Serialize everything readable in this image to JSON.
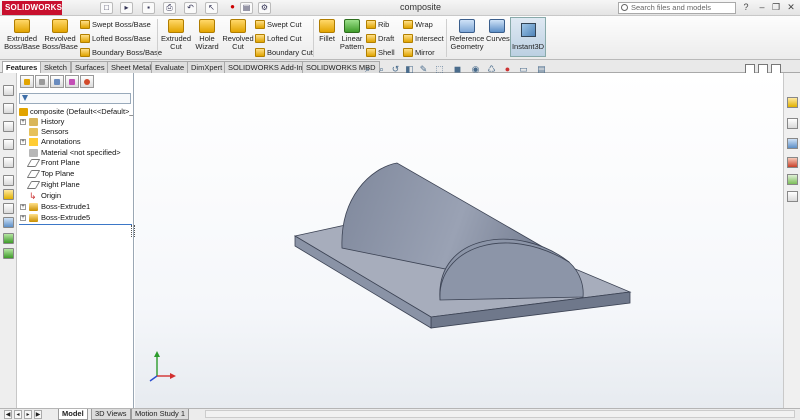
{
  "app": {
    "logo_text": "SOLIDWORKS",
    "doc_title": "composite"
  },
  "search": {
    "placeholder": "Search files and models"
  },
  "toolbar": {
    "extruded_boss": "Extruded\nBoss/Base",
    "revolved_boss": "Revolved\nBoss/Base",
    "swept_boss": "Swept Boss/Base",
    "lofted_boss": "Lofted Boss/Base",
    "boundary_boss": "Boundary Boss/Base",
    "extruded_cut": "Extruded\nCut",
    "hole_wizard": "Hole\nWizard",
    "revolved_cut": "Revolved\nCut",
    "swept_cut": "Swept Cut",
    "lofted_cut": "Lofted Cut",
    "boundary_cut": "Boundary Cut",
    "fillet": "Fillet",
    "linear_pattern": "Linear\nPattern",
    "rib": "Rib",
    "draft": "Draft",
    "shell": "Shell",
    "wrap": "Wrap",
    "intersect": "Intersect",
    "mirror": "Mirror",
    "reference_geometry": "Reference\nGeometry",
    "curves": "Curves",
    "instant3d": "Instant3D"
  },
  "tabs": [
    "Features",
    "Sketch",
    "Surfaces",
    "Sheet Metal",
    "Evaluate",
    "DimXpert",
    "SOLIDWORKS Add-Ins",
    "SOLIDWORKS MBD"
  ],
  "tree": {
    "root": "composite  (Default<<Default>_",
    "items": [
      "History",
      "Sensors",
      "Annotations",
      "Material <not specified>",
      "Front Plane",
      "Top Plane",
      "Right Plane",
      "Origin",
      "Boss-Extrude1",
      "Boss-Extrude5"
    ]
  },
  "bottom_tabs": [
    "Model",
    "3D Views",
    "Motion Study 1"
  ],
  "colors": {
    "accent": "#c8102e",
    "model_body": "#8f98ab",
    "model_shade": "#5d667a"
  }
}
